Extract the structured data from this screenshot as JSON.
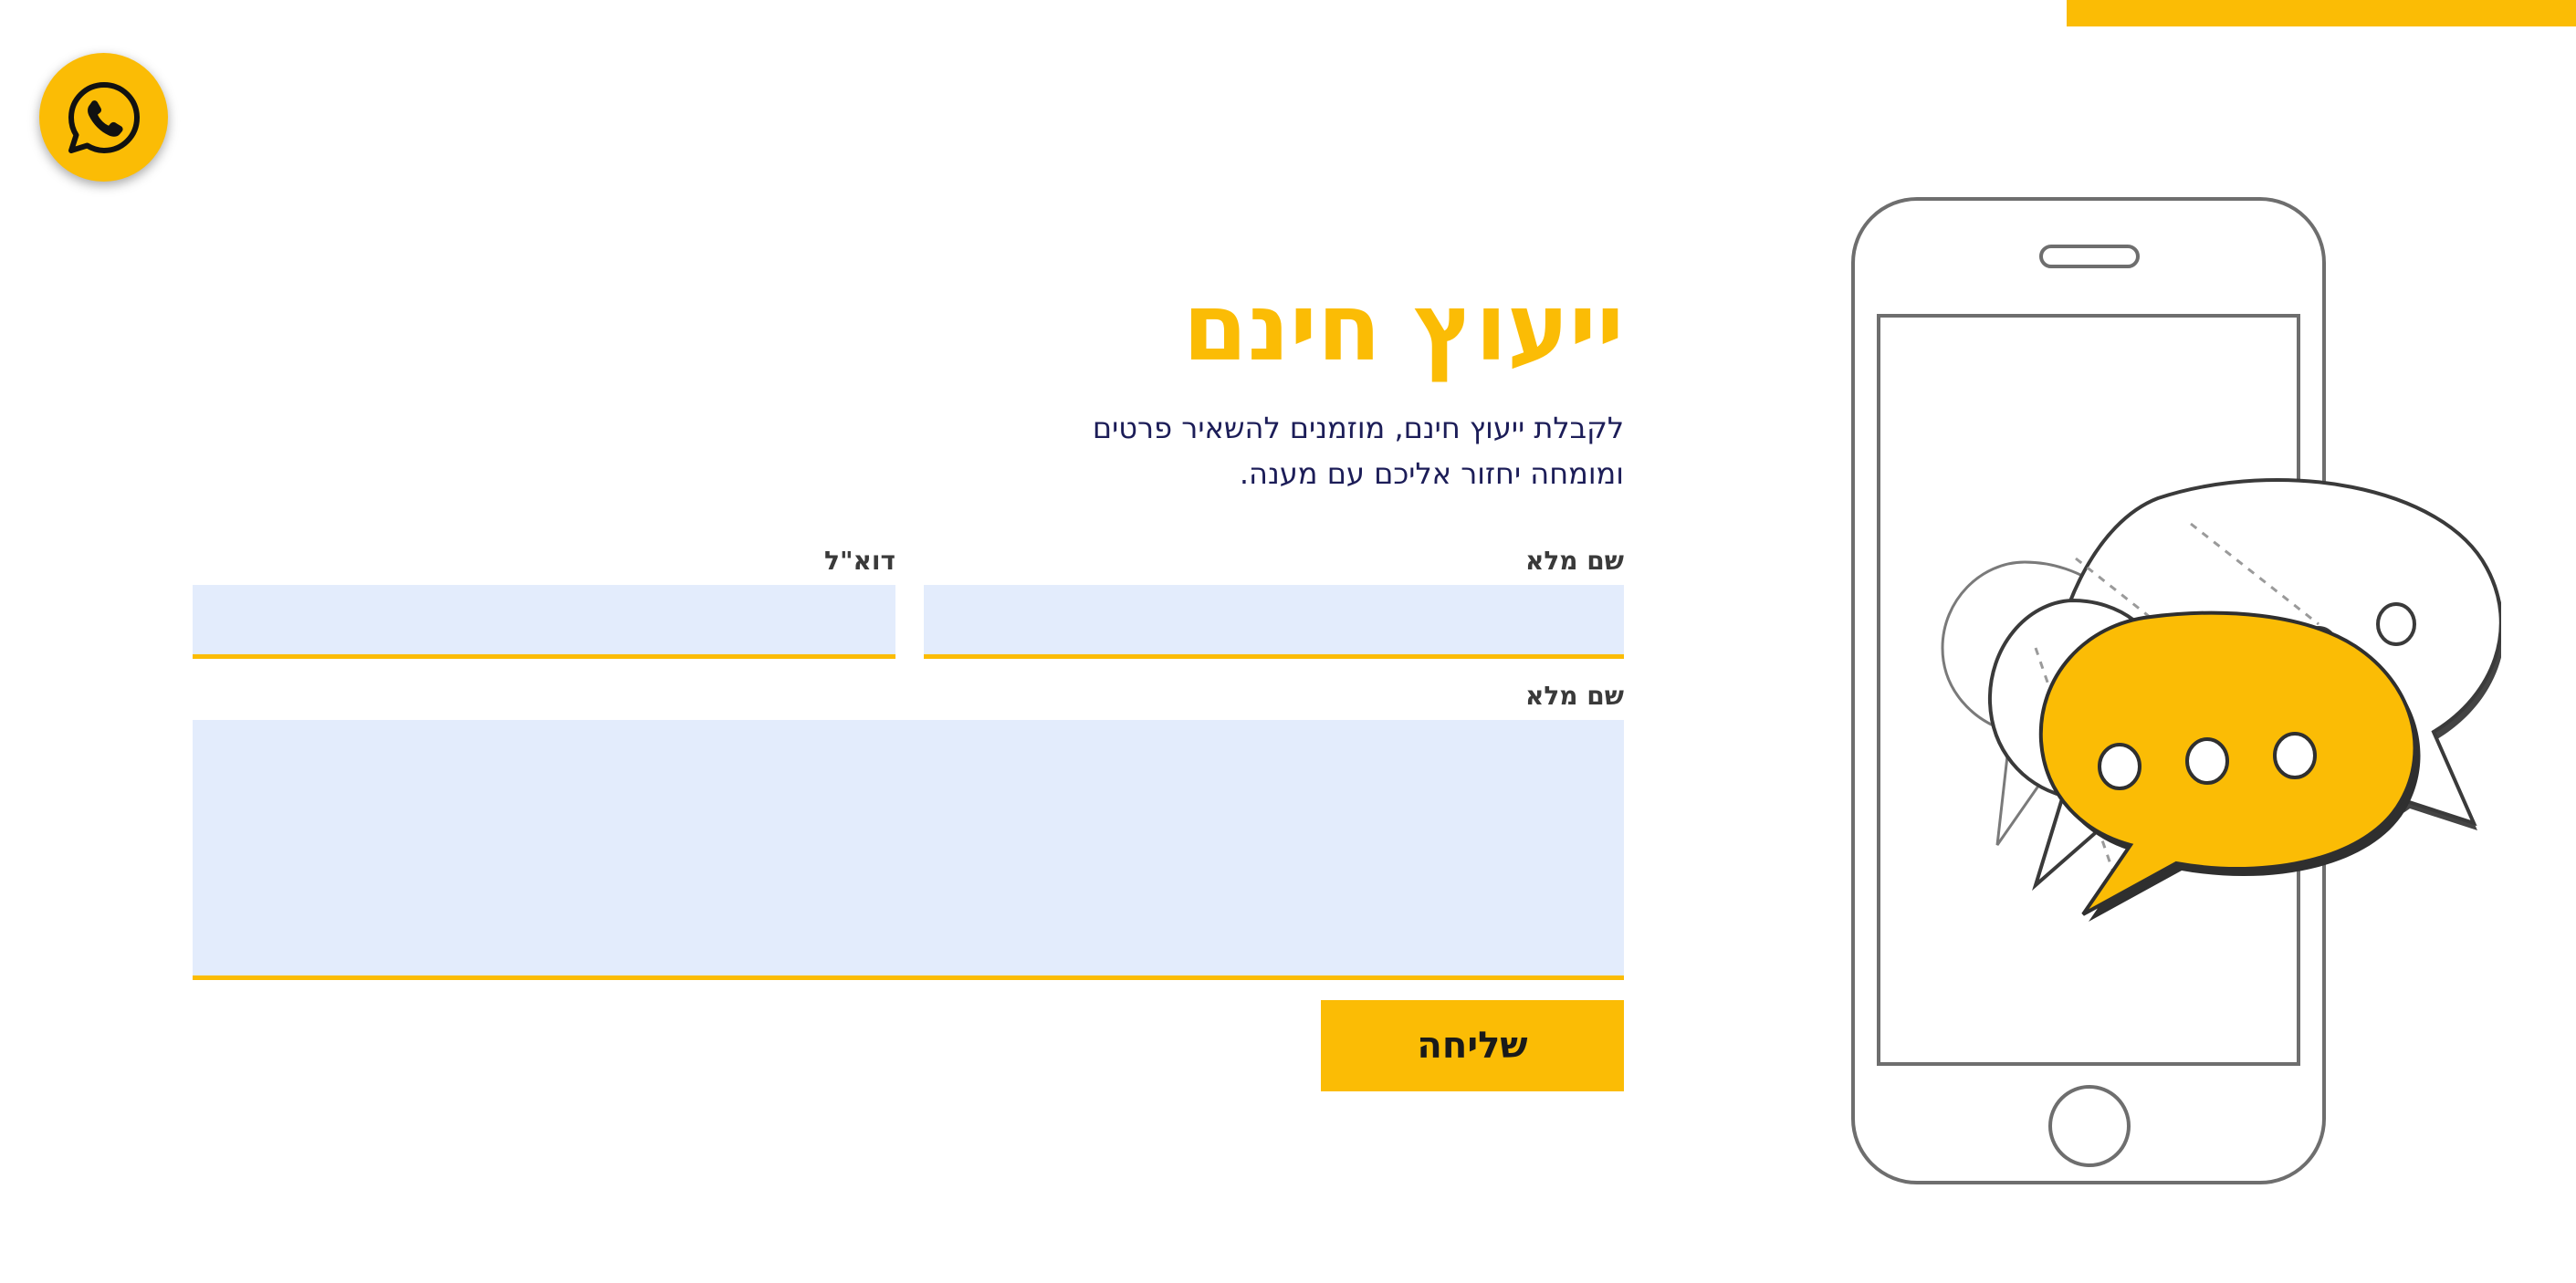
{
  "header": {
    "accent_color": "#FBBC05"
  },
  "whatsapp": {
    "icon": "whatsapp-icon"
  },
  "form": {
    "title": "ייעוץ חינם",
    "subtitle_line1": "לקבלת ייעוץ חינם, מוזמנים להשאיר פרטים",
    "subtitle_line2": "ומומחה יחזור אליכם עם מענה.",
    "name_label": "שם מלא",
    "email_label": "דוא\"ל",
    "message_label": "שם מלא",
    "name_value": "",
    "email_value": "",
    "message_value": "",
    "submit_label": "שליחה"
  },
  "illustration": {
    "icon": "phone-chat-bubbles-illustration"
  },
  "colors": {
    "accent": "#FBBC05",
    "input_bg": "#E3ECFC",
    "subtitle_text": "#1c1d58",
    "label_text": "#3a3a3a"
  }
}
